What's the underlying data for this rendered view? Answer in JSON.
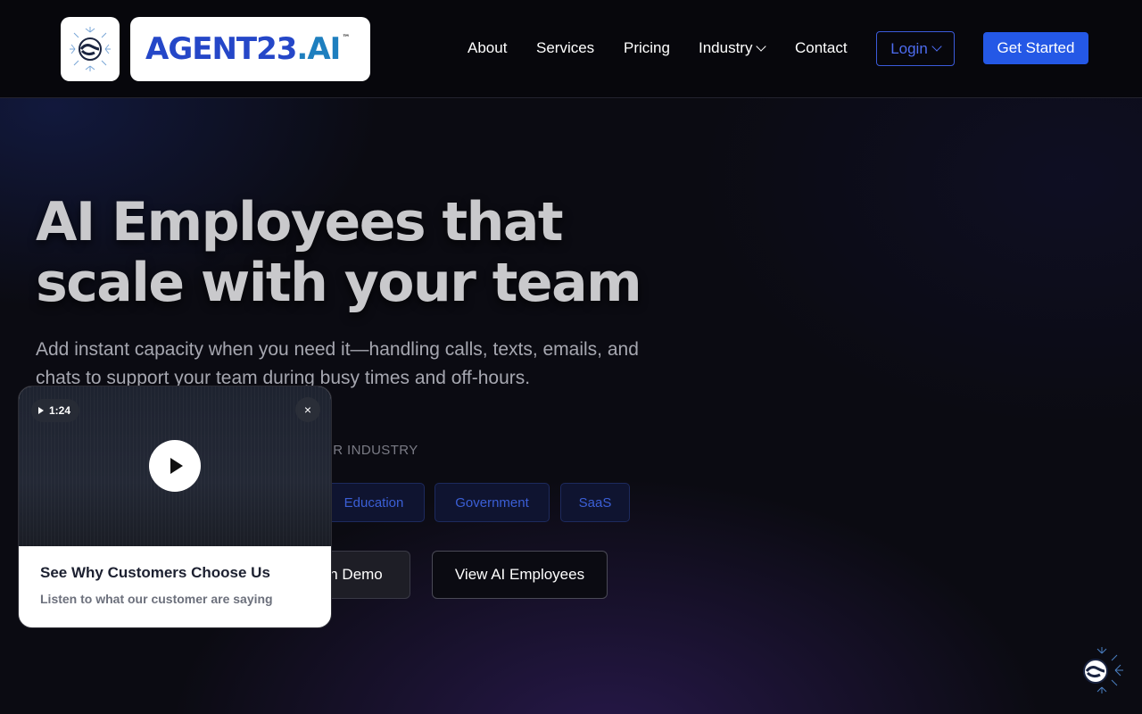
{
  "brand": {
    "part1": "AGENT23",
    "dot": ".",
    "part2": "AI",
    "tm": "™"
  },
  "nav": {
    "about": "About",
    "services": "Services",
    "pricing": "Pricing",
    "industry": "Industry",
    "contact": "Contact",
    "login": "Login",
    "get_started": "Get Started"
  },
  "hero": {
    "title_line1": "AI Employees that",
    "title_line2": "scale with your team",
    "subtitle": "Add instant capacity when you need it—handling calls, texts, emails, and chats to support your team during busy times and off-hours.",
    "industry_label": "UR INDUSTRY",
    "chips": [
      "Education",
      "Government",
      "SaaS"
    ],
    "cta_demo": "h Demo",
    "cta_view": "View AI Employees"
  },
  "video_card": {
    "duration": "1:24",
    "close": "×",
    "title": "See Why Customers Choose Us",
    "subtitle": "Listen to what our customer are saying"
  },
  "colors": {
    "accent": "#2458e6",
    "chip_text": "#3b5fd6",
    "background": "#0b0b12"
  },
  "icons": [
    "logo-mark-icon",
    "chevron-down-icon",
    "play-icon",
    "close-icon",
    "chat-widget-icon"
  ]
}
